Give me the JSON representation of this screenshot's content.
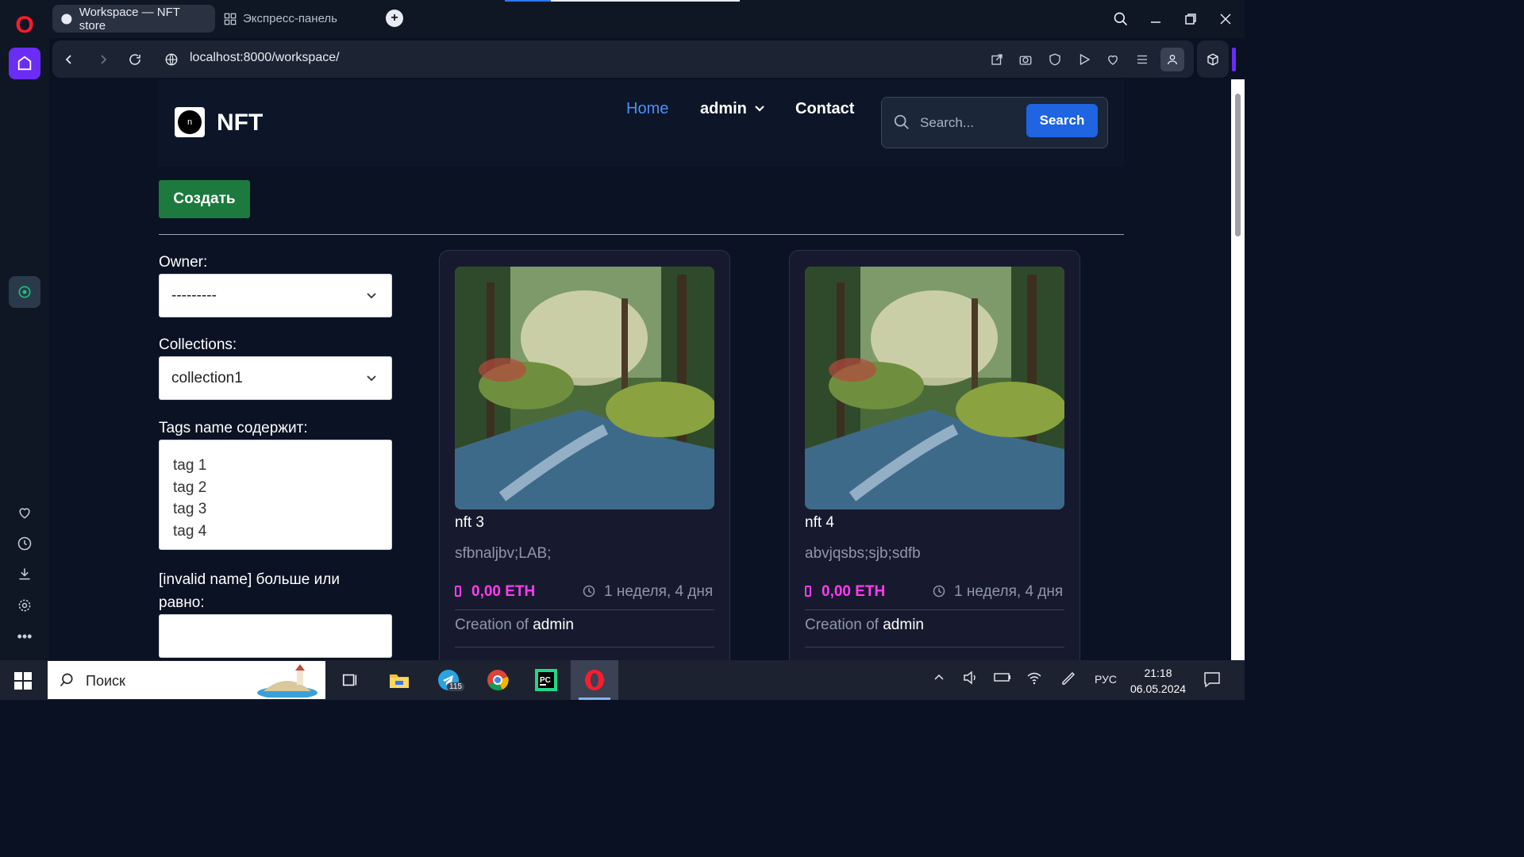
{
  "browser": {
    "tabs": [
      {
        "label": "Workspace — NFT store",
        "active": true
      },
      {
        "label": "Экспресс-панель",
        "active": false
      }
    ],
    "url_host": "localhost",
    "url_path": ":8000/workspace/"
  },
  "header": {
    "logo_text": "n",
    "brand": "NFT",
    "nav": {
      "home": "Home",
      "admin": "admin",
      "contact": "Contact"
    },
    "search_placeholder": "Search...",
    "search_button": "Search"
  },
  "create_button": "Создать",
  "filters": {
    "owner_label": "Owner:",
    "owner_value": "---------",
    "collections_label": "Collections:",
    "collections_value": "collection1",
    "tags_label": "Tags name содержит:",
    "tags": [
      "tag 1",
      "tag 2",
      "tag 3",
      "tag 4"
    ],
    "invalid_label_line1": "[invalid name] больше или",
    "invalid_label_line2": "равно:"
  },
  "cards": [
    {
      "title": "nft 3",
      "desc": "sfbnaljbv;LAB;",
      "price": "0,00 ETH",
      "time": "1 неделя, 4 дня",
      "creator_prefix": "Creation of",
      "creator": "admin"
    },
    {
      "title": "nft 4",
      "desc": "abvjqsbs;sjb;sdfb",
      "price": "0,00 ETH",
      "time": "1 неделя, 4 дня",
      "creator_prefix": "Creation of",
      "creator": "admin"
    }
  ],
  "taskbar": {
    "search_text": "Поиск",
    "telegram_badge": "115",
    "lang": "РУС",
    "time": "21:18",
    "date": "06.05.2024"
  },
  "colors": {
    "accent_blue": "#1f64e0",
    "create_green": "#1c7a3e",
    "price_pink": "#ff3cf0",
    "opera_red": "#ff1b2d"
  }
}
